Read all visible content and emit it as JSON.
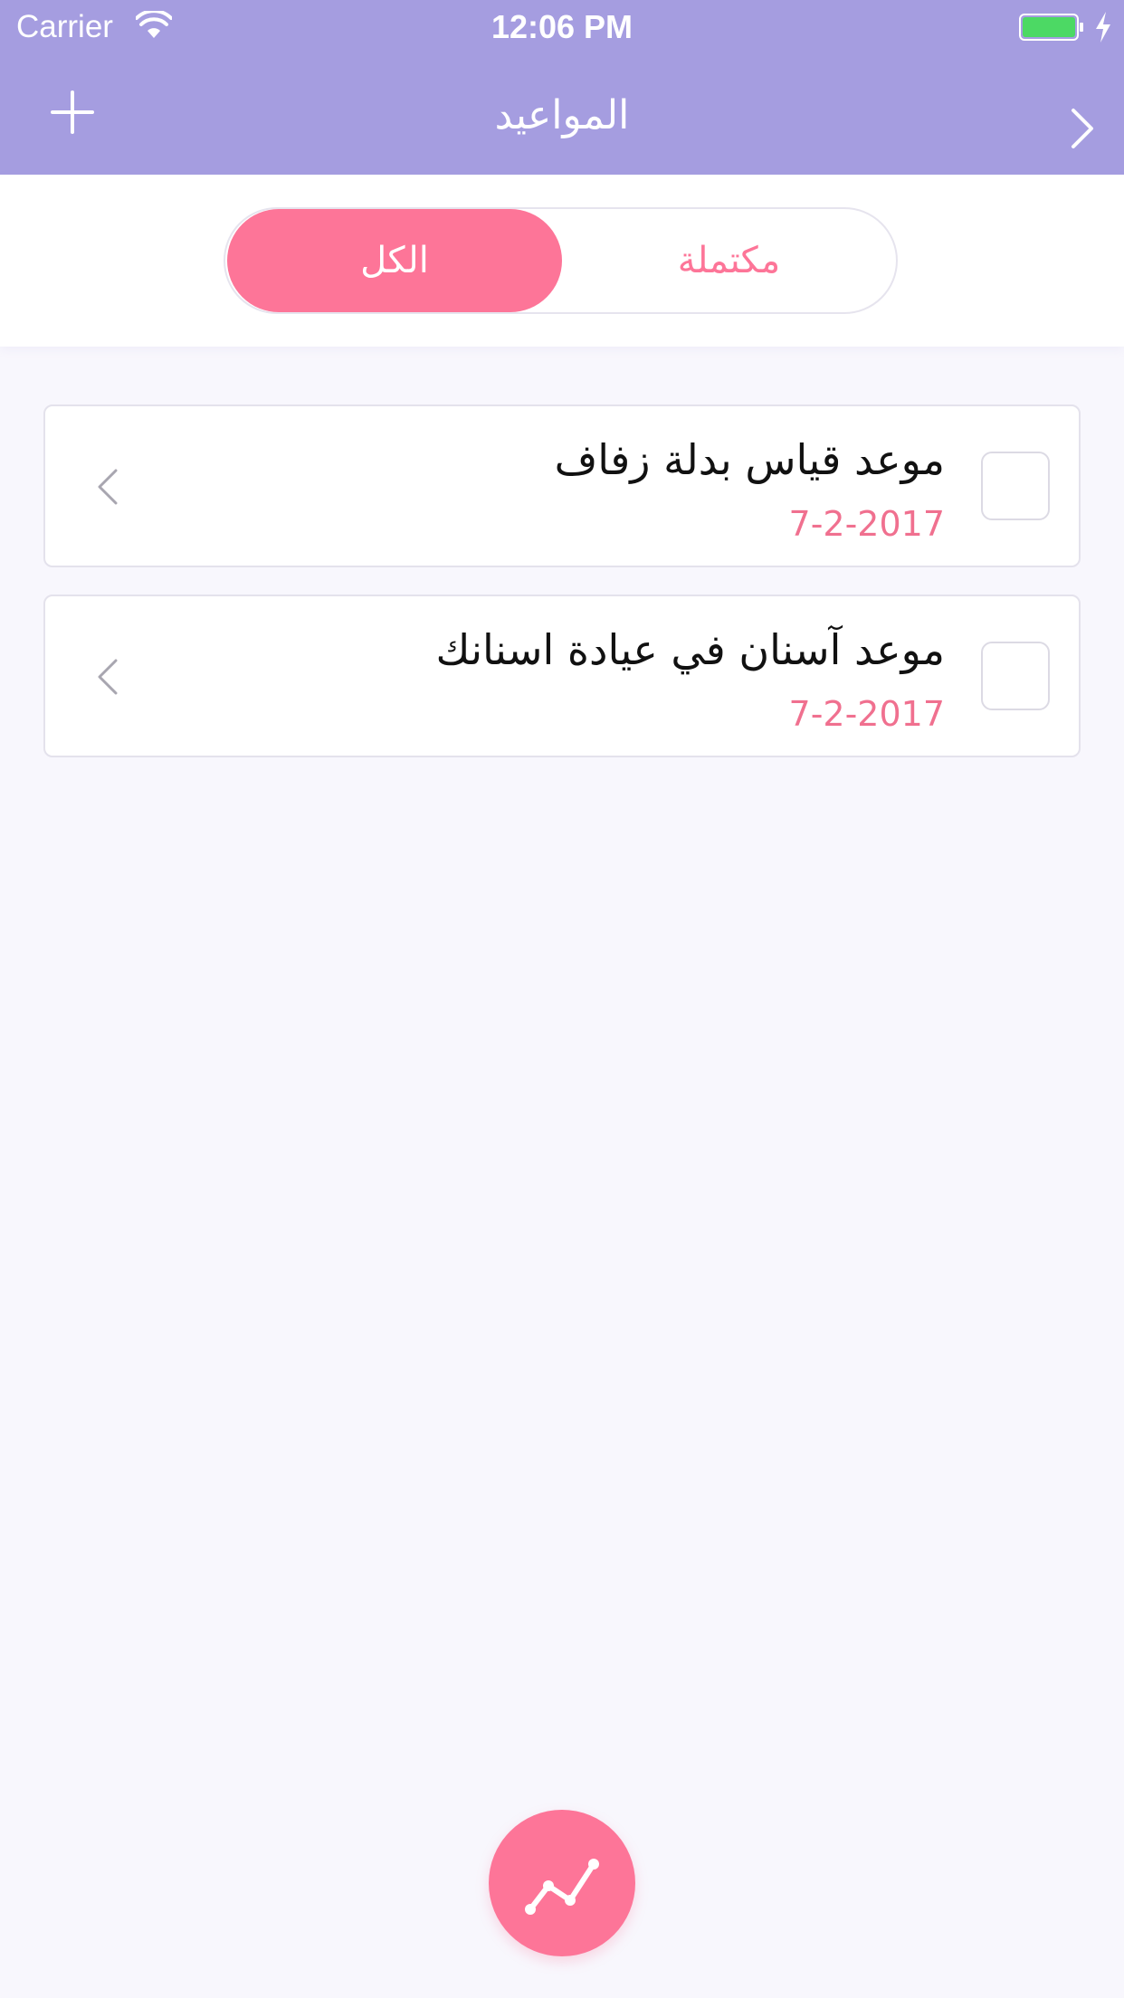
{
  "status_bar": {
    "carrier": "Carrier",
    "time": "12:06 PM",
    "battery_color": "#4cd964"
  },
  "nav": {
    "title": "المواعيد",
    "add_icon": "plus-icon",
    "back_icon": "chevron-right-icon",
    "background": "#a59de0"
  },
  "segments": {
    "all_label": "الكل",
    "completed_label": "مكتملة",
    "selected": "all",
    "accent": "#fd7598"
  },
  "appointments": [
    {
      "title": "موعد قياس بدلة زفاف",
      "date": "7-2-2017",
      "completed": false
    },
    {
      "title": "موعد آسنان في عيادة اسنانك",
      "date": "7-2-2017",
      "completed": false
    }
  ],
  "fab": {
    "icon": "stats-chart-icon"
  }
}
